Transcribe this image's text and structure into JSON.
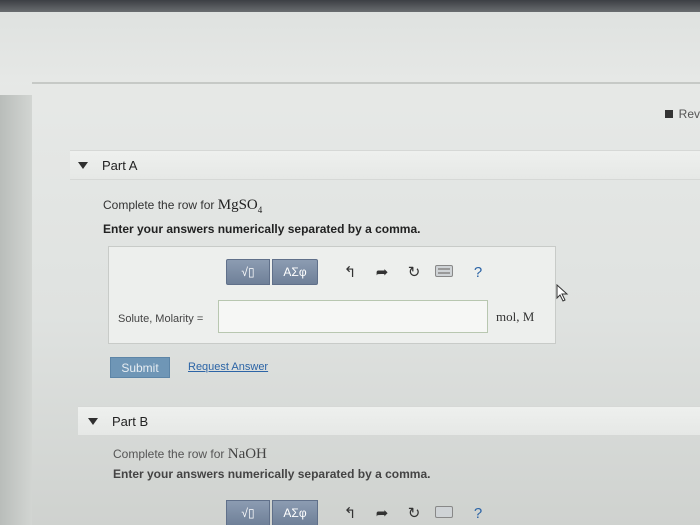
{
  "review_link": {
    "label": "Rev"
  },
  "part_a": {
    "title": "Part A",
    "prompt_prefix": "Complete the row for",
    "compound_base": "MgSO",
    "compound_sub": "4",
    "instruction": "Enter your answers numerically separated by a comma.",
    "toolbar": {
      "templates_label": "√▯",
      "greek_label": "ΑΣφ",
      "help_label": "?"
    },
    "answer_label": "Solute, Molarity =",
    "answer_value": "",
    "units": "mol, M",
    "submit_label": "Submit",
    "request_answer_label": "Request Answer"
  },
  "part_b": {
    "title": "Part B",
    "prompt_prefix": "Complete the row for",
    "compound": "NaOH",
    "instruction": "Enter your answers numerically separated by a comma.",
    "toolbar": {
      "templates_label": "√▯",
      "greek_label": "ΑΣφ",
      "help_label": "?"
    }
  },
  "colors": {
    "accent_blue": "#6f96b6",
    "toolbar_blue": "#7b8ca6",
    "link_blue": "#2c64a6"
  }
}
